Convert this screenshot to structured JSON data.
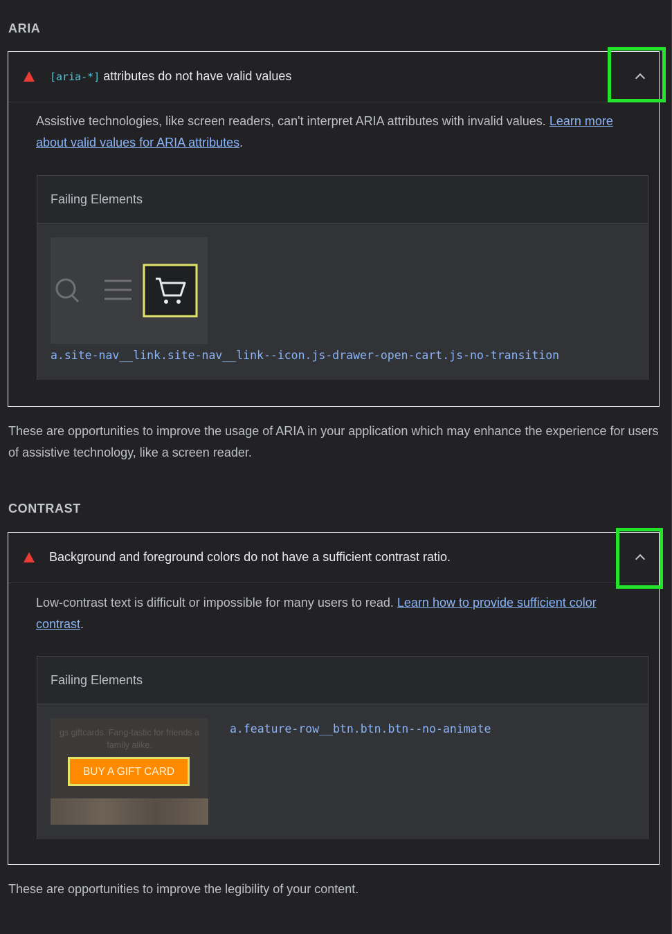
{
  "aria_section": {
    "title": "ARIA",
    "audit": {
      "title_code": "[aria-*]",
      "title_text": "attributes do not have valid values",
      "description": "Assistive technologies, like screen readers, can't interpret ARIA attributes with invalid values.",
      "link_text": "Learn more about valid values for ARIA attributes",
      "trailing": ".",
      "failing_header": "Failing Elements",
      "selector": "a.site-nav__link.site-nav__link--icon.js-drawer-open-cart.js-no-transition"
    },
    "footer": "These are opportunities to improve the usage of ARIA in your application which may enhance the experience for users of assistive technology, like a screen reader."
  },
  "contrast_section": {
    "title": "CONTRAST",
    "audit": {
      "title_text": "Background and foreground colors do not have a sufficient contrast ratio.",
      "description": "Low-contrast text is difficult or impossible for many users to read.",
      "link_text": "Learn how to provide sufficient color contrast",
      "trailing": ".",
      "failing_header": "Failing Elements",
      "selector": "a.feature-row__btn.btn.btn--no-animate",
      "thumb_text_line1": "gs giftcards. Fang-tastic for friends a",
      "thumb_text_line2": "family alike.",
      "thumb_button": "BUY A GIFT CARD"
    },
    "footer": "These are opportunities to improve the legibility of your content."
  },
  "colors": {
    "warning": "#eb3b36",
    "highlight": "#22e52b",
    "link": "#8ab4f8",
    "gift_button": "#ff8a00"
  }
}
